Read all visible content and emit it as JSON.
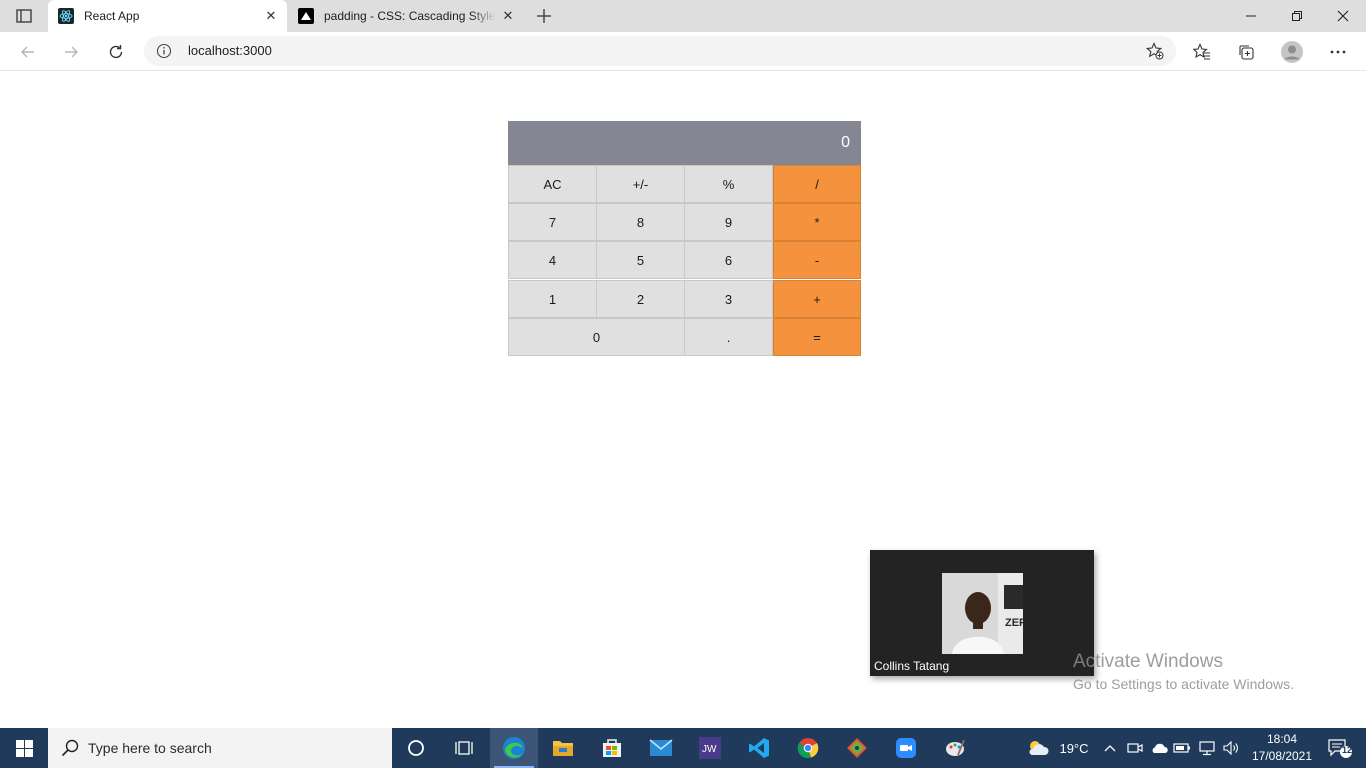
{
  "browser": {
    "tabs": [
      {
        "title": "React App",
        "active": true,
        "favicon": "react-icon"
      },
      {
        "title": "padding - CSS: Cascading Style Sheets | MDN",
        "active": false,
        "favicon": "mdn-icon"
      }
    ],
    "address": "localhost:3000"
  },
  "calculator": {
    "display": "0",
    "keys": {
      "ac": "AC",
      "sign": "+/-",
      "percent": "%",
      "divide": "/",
      "seven": "7",
      "eight": "8",
      "nine": "9",
      "multiply": "*",
      "four": "4",
      "five": "5",
      "six": "6",
      "minus": "-",
      "one": "1",
      "two": "2",
      "three": "3",
      "plus": "+",
      "zero": "0",
      "dot": ".",
      "equals": "="
    },
    "colors": {
      "display": "#858694",
      "key": "#e0e0e0",
      "operator": "#f5923e"
    }
  },
  "video_call": {
    "participant": "Collins Tatang"
  },
  "watermark": {
    "line1": "Activate Windows",
    "line2": "Go to Settings to activate Windows."
  },
  "taskbar": {
    "search_placeholder": "Type here to search",
    "apps": [
      "cortana-icon",
      "task-view-icon",
      "edge-icon",
      "file-explorer-icon",
      "store-icon",
      "mail-icon",
      "jw-library-icon",
      "vscode-icon",
      "chrome-icon",
      "git-icon",
      "zoom-icon",
      "paint-icon"
    ],
    "weather": "19°C",
    "time": "18:04",
    "date": "17/08/2021",
    "notifications": "12"
  }
}
